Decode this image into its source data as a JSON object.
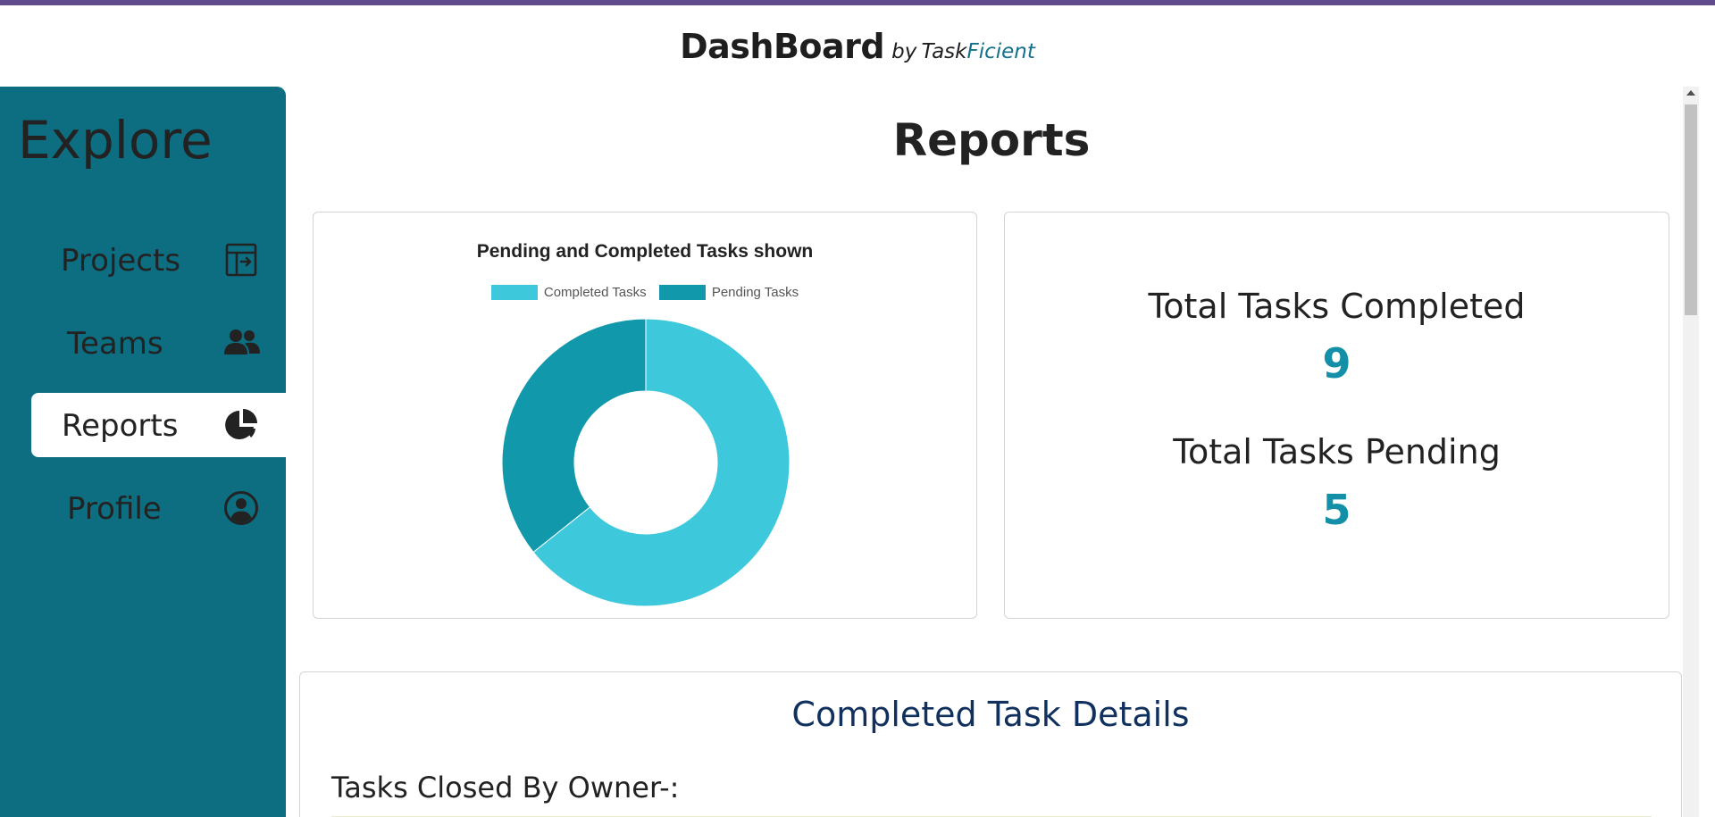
{
  "brand": {
    "name": "DashBoard",
    "by": "by",
    "task": "Task",
    "ficient": "Ficient"
  },
  "sidebar": {
    "title": "Explore",
    "items": [
      {
        "label": "Projects",
        "icon": "projects-icon",
        "active": false
      },
      {
        "label": "Teams",
        "icon": "users-icon",
        "active": false
      },
      {
        "label": "Reports",
        "icon": "pie-chart-icon",
        "active": true
      },
      {
        "label": "Profile",
        "icon": "user-circle-icon",
        "active": false
      }
    ]
  },
  "main": {
    "title": "Reports",
    "stats": {
      "completed_label": "Total Tasks Completed",
      "completed_value": "9",
      "pending_label": "Total Tasks Pending",
      "pending_value": "5"
    },
    "details": {
      "title": "Completed Task Details",
      "subtitle": "Tasks Closed By Owner-:"
    }
  },
  "colors": {
    "completed": "#3dc8db",
    "pending": "#1298ab",
    "sidebar": "#0d6e82",
    "accent": "#138fa7"
  },
  "chart_data": {
    "type": "pie",
    "title": "Pending and Completed Tasks shown",
    "categories": [
      "Completed Tasks",
      "Pending Tasks"
    ],
    "values": [
      9,
      5
    ],
    "colors": [
      "#3dc8db",
      "#1298ab"
    ],
    "legend": "top",
    "doughnut": true
  }
}
